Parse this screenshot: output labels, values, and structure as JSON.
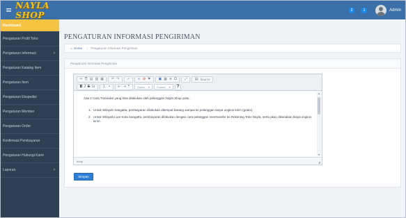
{
  "topbar": {
    "menu_icon": "hamburger-icon",
    "logo": "NAYLA SHOP",
    "notif_count_1": "2",
    "notif_count_2": "1",
    "user_label": "Admin"
  },
  "sidebar": {
    "items": [
      {
        "label": "Dashboard",
        "active": true
      },
      {
        "label": "Pengaturan Profil Toko"
      },
      {
        "label": "Pengaturan Informasi",
        "caret": "›"
      },
      {
        "label": "Pengaturan Katalog Item"
      },
      {
        "label": "Pengaturan Item"
      },
      {
        "label": "Pengaturan Ekspedisi"
      },
      {
        "label": "Pengaturan Member"
      },
      {
        "label": "Pengaturan Order"
      },
      {
        "label": "Konfirmasi Pembayaran"
      },
      {
        "label": "Pengaturan Hubungi Kami"
      },
      {
        "label": "Laporan",
        "caret": "›"
      }
    ]
  },
  "main": {
    "title": "PENGATURAN INFORMASI PENGIRIMAN",
    "breadcrumb": {
      "home": "Home",
      "current": "Pengaturan Informasi Pengiriman"
    },
    "panel_title": "Pengaturan Informasi Pengiriman",
    "toolbar": {
      "source_label": "Source",
      "styles_label": "Styles",
      "format_label": "Format",
      "help": "?"
    },
    "editor": {
      "intro": "Ada 2 Cara Transaksi yang bisa dilakukan oleh pelanggan Nayla Shop yaitu :",
      "items": [
        "Untuk Wilayah Sangatta, pembayaran dilakukan ditempat barang sampai ke pelanggan tanpa ongkos kirim (gratis).",
        "Untuk Wilayah Luar Kota Sangatta, pembayaran dilakukan dengan  cara pelanggan mentransfer ke Rekening Toko Nayla, serta akan dikenakan biaya ongkos kirim."
      ],
      "footer_path": "body"
    },
    "save_label": "Simpan"
  },
  "colors": {
    "topbar": "#3b6fa7",
    "sidebar": "#2f4054",
    "active_item": "#f6c343",
    "save_button": "#2f7ed8",
    "logo": "#f3c51a"
  }
}
